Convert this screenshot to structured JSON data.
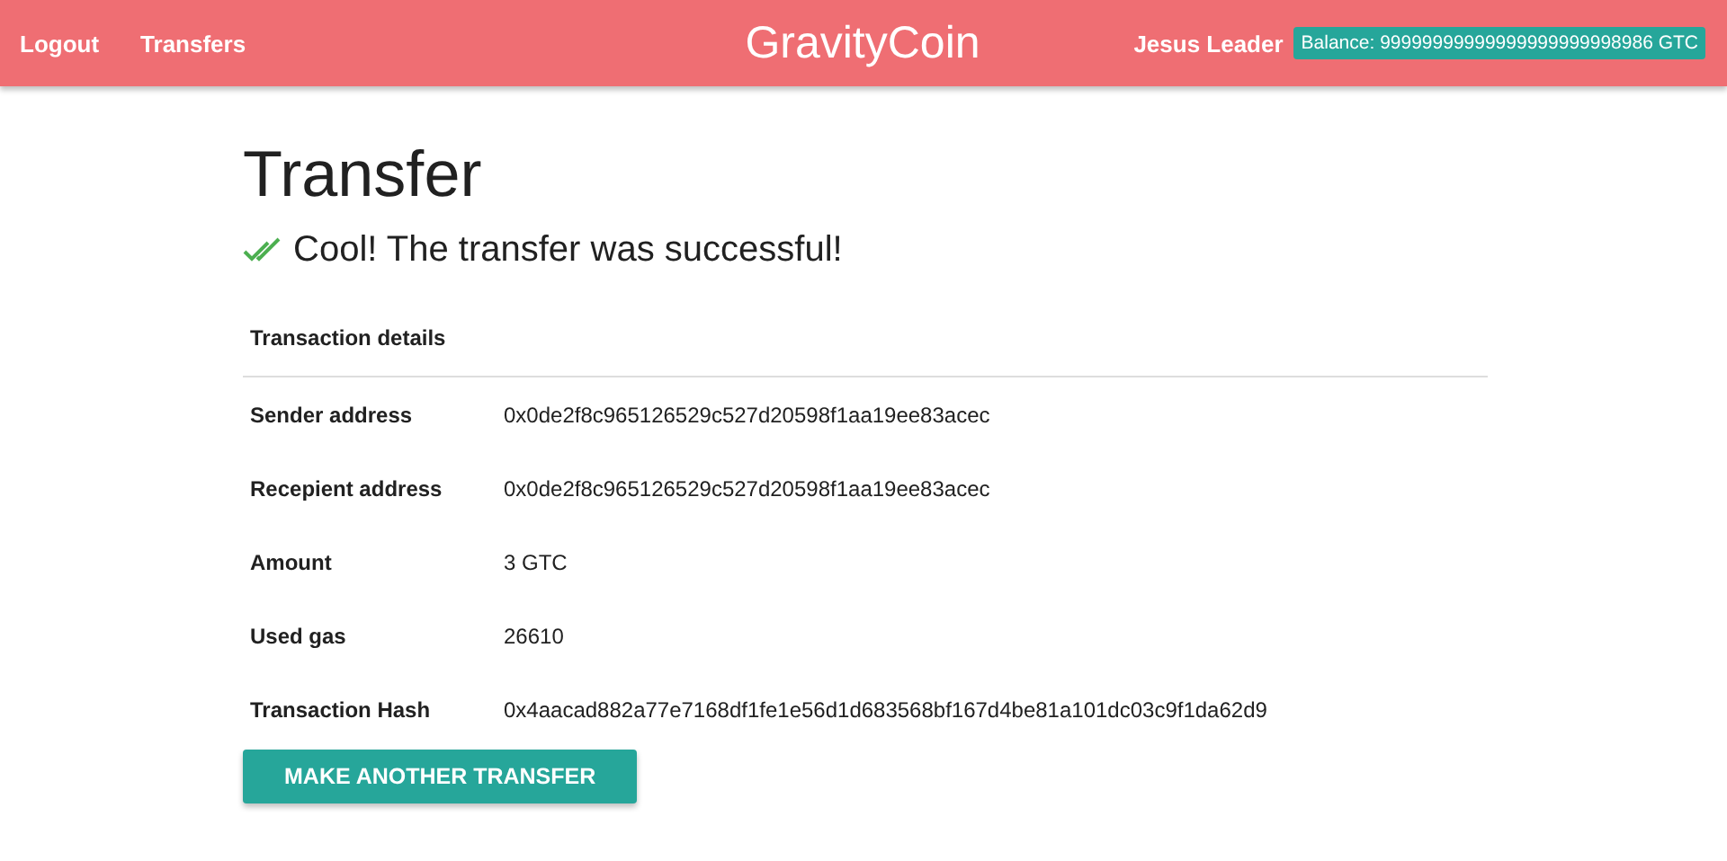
{
  "navbar": {
    "links": [
      "Logout",
      "Transfers"
    ],
    "brand": "GravityCoin",
    "user": "Jesus Leader",
    "balance": "Balance: 99999999999999999999998986 GTC"
  },
  "page": {
    "title": "Transfer",
    "message": "Cool! The transfer was successful!"
  },
  "table": {
    "header": "Transaction details",
    "rows": [
      {
        "label": "Sender address",
        "value": "0x0de2f8c965126529c527d20598f1aa19ee83acec"
      },
      {
        "label": "Recepient address",
        "value": "0x0de2f8c965126529c527d20598f1aa19ee83acec"
      },
      {
        "label": "Amount",
        "value": "3 GTC"
      },
      {
        "label": "Used gas",
        "value": "26610"
      },
      {
        "label": "Transaction Hash",
        "value": "0x4aacad882a77e7168df1fe1e56d1d683568bf167d4be81a101dc03c9f1da62d9"
      }
    ]
  },
  "button": "MAKE ANOTHER TRANSFER"
}
